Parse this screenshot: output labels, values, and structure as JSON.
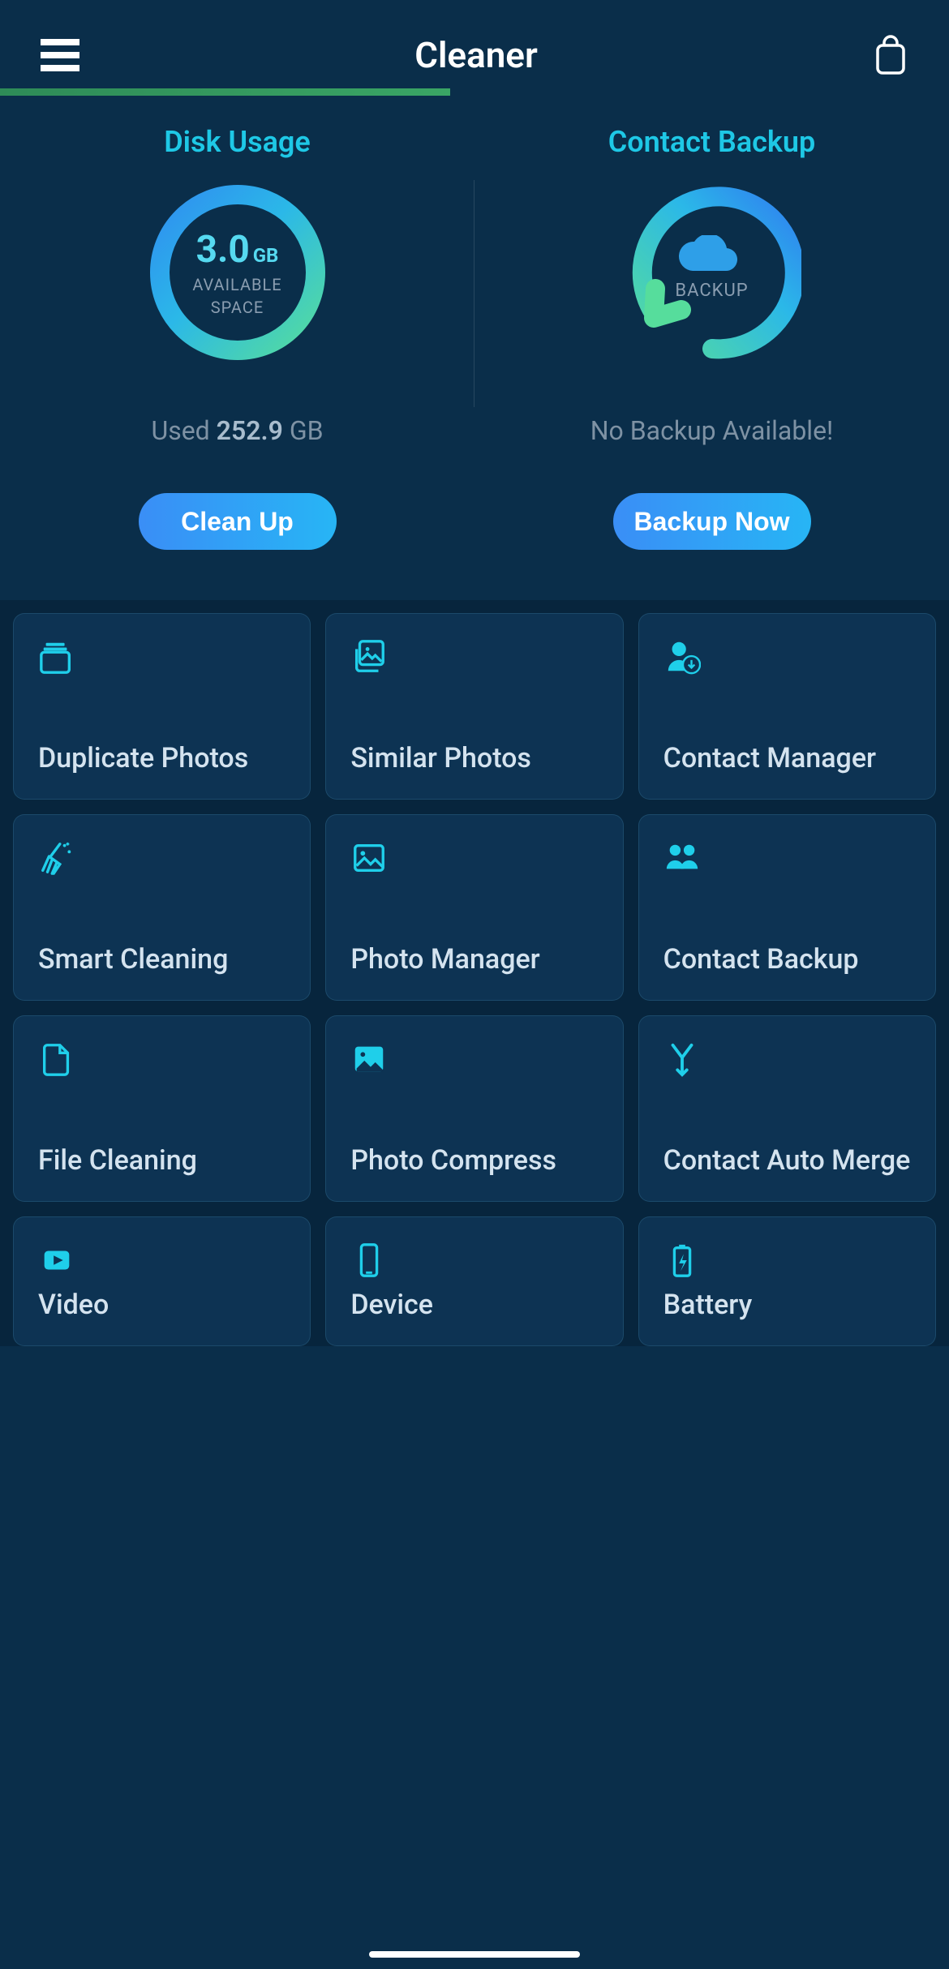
{
  "header": {
    "title": "Cleaner"
  },
  "overview": {
    "disk": {
      "title": "Disk Usage",
      "value": "3.0",
      "unit": "GB",
      "subtitle1": "AVAILABLE",
      "subtitle2": "SPACE",
      "status_prefix": "Used ",
      "status_value": "252.9",
      "status_suffix": " GB",
      "button": "Clean Up"
    },
    "backup": {
      "title": "Contact Backup",
      "label": "BACKUP",
      "status": "No Backup Available!",
      "button": "Backup Now"
    }
  },
  "tools": [
    {
      "label": "Duplicate Photos",
      "icon": "stacked-photos-icon"
    },
    {
      "label": "Similar Photos",
      "icon": "photo-stack-icon"
    },
    {
      "label": "Contact Manager",
      "icon": "person-down-icon"
    },
    {
      "label": "Smart Cleaning",
      "icon": "broom-icon"
    },
    {
      "label": "Photo Manager",
      "icon": "photo-icon"
    },
    {
      "label": "Contact Backup",
      "icon": "people-icon"
    },
    {
      "label": "File Cleaning",
      "icon": "file-icon"
    },
    {
      "label": "Photo Compress",
      "icon": "photo-fill-icon"
    },
    {
      "label": "Contact Auto Merge",
      "icon": "merge-icon"
    },
    {
      "label": "Video",
      "icon": "video-icon"
    },
    {
      "label": "Device",
      "icon": "device-icon"
    },
    {
      "label": "Battery",
      "icon": "battery-icon"
    }
  ]
}
